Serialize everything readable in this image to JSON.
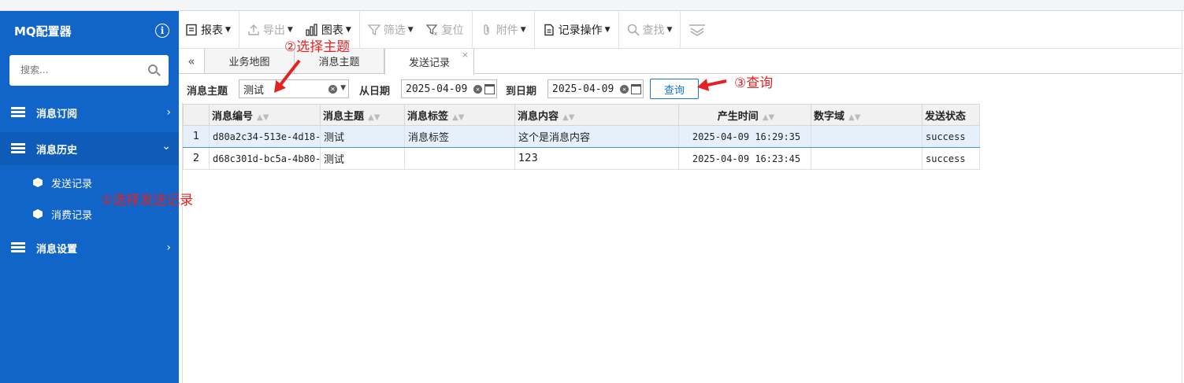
{
  "sidebar": {
    "title": "MQ配置器",
    "search_placeholder": "搜索...",
    "nav": [
      {
        "label": "消息订阅",
        "chevron": "›"
      },
      {
        "label": "消息历史",
        "chevron": "⌄"
      },
      {
        "label": "消息设置",
        "chevron": "›"
      }
    ],
    "sub_items": [
      {
        "label": "发送记录"
      },
      {
        "label": "消费记录"
      }
    ]
  },
  "toolbar": {
    "report": "报表",
    "export": "导出",
    "chart": "图表",
    "filter": "筛选",
    "reset": "复位",
    "attachment": "附件",
    "record_ops": "记录操作",
    "find": "查找"
  },
  "tabs": {
    "collapse_glyph": "«",
    "items": [
      {
        "label": "业务地图"
      },
      {
        "label": "消息主题"
      },
      {
        "label": "发送记录"
      }
    ],
    "close_glyph": "×"
  },
  "filter": {
    "topic_label": "消息主题",
    "topic_value": "测试",
    "from_label": "从日期",
    "from_value": "2025-04-09",
    "to_label": "到日期",
    "to_value": "2025-04-09",
    "query_button": "查询"
  },
  "table": {
    "columns": [
      "消息编号",
      "消息主题",
      "消息标签",
      "消息内容",
      "产生时间",
      "数字域",
      "发送状态"
    ],
    "rows": [
      {
        "n": "1",
        "id": "d80a2c34-513e-4d18-",
        "topic": "测试",
        "tag": "消息标签",
        "content": "这个是消息内容",
        "time": "2025-04-09 16:29:35",
        "num": "",
        "status": "success"
      },
      {
        "n": "2",
        "id": "d68c301d-bc5a-4b80-",
        "topic": "测试",
        "tag": "",
        "content": "123",
        "time": "2025-04-09 16:23:45",
        "num": "",
        "status": "success"
      }
    ]
  },
  "annotations": {
    "step1": "①选择发送记录",
    "step2": "②选择主题",
    "step3": "③查询"
  },
  "colors": {
    "sidebar": "#1164c8",
    "accent": "#1a73c9",
    "annotation": "#e52222"
  }
}
